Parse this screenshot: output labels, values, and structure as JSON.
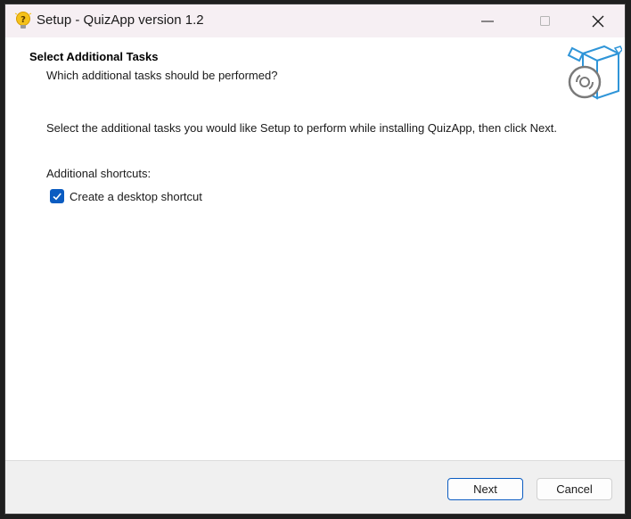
{
  "window": {
    "title": "Setup - QuizApp version 1.2",
    "icons": {
      "app": "quiz-app-icon",
      "minimize": "minimize-icon",
      "maximize": "maximize-icon",
      "close": "close-icon"
    }
  },
  "header": {
    "title": "Select Additional Tasks",
    "subtitle": "Which additional tasks should be performed?",
    "image": "setup-box-disc-icon"
  },
  "content": {
    "description": "Select the additional tasks you would like Setup to perform while installing QuizApp, then click Next.",
    "shortcuts_label": "Additional shortcuts:",
    "tasks": [
      {
        "label": "Create a desktop shortcut",
        "checked": true
      }
    ]
  },
  "footer": {
    "next_label": "Next",
    "cancel_label": "Cancel"
  },
  "colors": {
    "accent": "#0b5cc1",
    "titlebar": "#f6eff3",
    "footer": "#f0f0f0"
  }
}
